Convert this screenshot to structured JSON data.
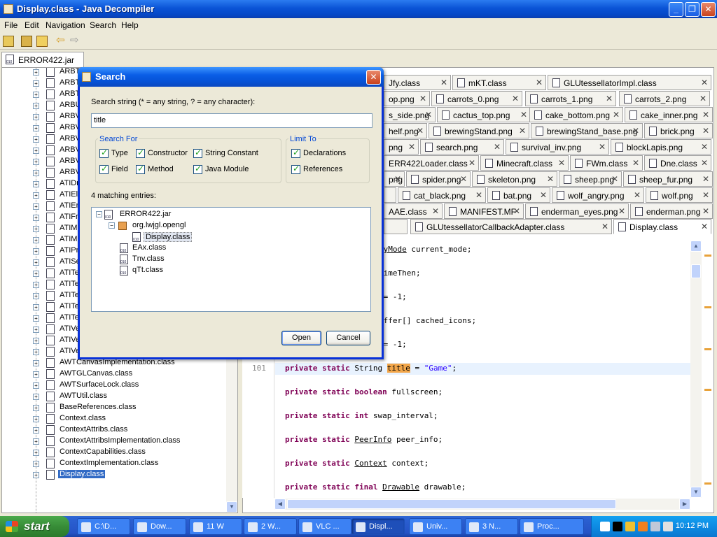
{
  "window": {
    "title": "Display.class - Java Decompiler"
  },
  "menu": [
    "File",
    "Edit",
    "Navigation",
    "Search",
    "Help"
  ],
  "jar_tab": "ERROR422.jar",
  "tree": {
    "items": [
      "ARBT",
      "ARBTr",
      "ARBTr",
      "ARBU",
      "ARBVe",
      "ARBVe",
      "ARBVe",
      "ARBVe",
      "ARBVe",
      "ARBVe",
      "ATIDr",
      "ATIEle",
      "ATIEn",
      "ATIFra",
      "ATIMa",
      "ATIMe",
      "ATIPn",
      "ATISe",
      "ATITe",
      "ATITe",
      "ATITe",
      "ATITe",
      "ATITe",
      "ATIVertexArrayObject.class",
      "ATIVertexAttribArrayObject.class",
      "ATIVertexStreams.class",
      "AWTCanvasImplementation.class",
      "AWTGLCanvas.class",
      "AWTSurfaceLock.class",
      "AWTUtil.class",
      "BaseReferences.class",
      "Context.class",
      "ContextAttribs.class",
      "ContextAttribsImplementation.class",
      "ContextCapabilities.class",
      "ContextImplementation.class",
      "Display.class"
    ]
  },
  "editor_tabs": [
    [
      "Jfy.class",
      "mKT.class",
      "GLUtessellatorImpl.class"
    ],
    [
      "op.png",
      "carrots_0.png",
      "carrots_1.png",
      "carrots_2.png"
    ],
    [
      "s_side.png",
      "cactus_top.png",
      "cake_bottom.png",
      "cake_inner.png"
    ],
    [
      "helf.png",
      "brewingStand.png",
      "brewingStand_base.png",
      "brick.png"
    ],
    [
      "png",
      "search.png",
      "survival_inv.png",
      "blockLapis.png"
    ],
    [
      "ERR422Loader.class",
      "Minecraft.class",
      "FWm.class",
      "Dne.class"
    ],
    [
      "png",
      "spider.png",
      "skeleton.png",
      "sheep.png",
      "sheep_fur.png"
    ],
    [
      "",
      "cat_black.png",
      "bat.png",
      "wolf_angry.png",
      "wolf.png"
    ],
    [
      "AAE.class",
      "MANIFEST.MF",
      "enderman_eyes.png",
      "enderman.png"
    ],
    [
      "",
      "GLUtessellatorCallbackAdapter.class",
      "Display.class"
    ]
  ],
  "code": {
    "lines": [
      {
        "pre": "",
        "kw": "",
        "mid": "",
        "ul": "ayMode",
        "rest": " current_mode;"
      },
      {
        "pre": "",
        "kw": "",
        "mid": "",
        "ul": "",
        "rest": "timeThen;"
      },
      {
        "pre": "",
        "kw": "",
        "mid": "",
        "ul": "",
        "rest": " = -1;"
      },
      {
        "pre": "",
        "kw": "",
        "mid": "",
        "ul": "",
        "rest": "uffer[] cached_icons;"
      },
      {
        "pre": "",
        "kw": "",
        "mid": "",
        "ul": "",
        "rest": " = -1;"
      }
    ],
    "current_line_number": "101",
    "line101": {
      "kw": "private static",
      "type": " String ",
      "hl": "title",
      "eq": " = ",
      "str": "\"Game\"",
      "end": ";"
    },
    "more": [
      {
        "kw": "private static boolean",
        "ul": "",
        "rest": " fullscreen;"
      },
      {
        "kw": "private static int",
        "ul": "",
        "rest": " swap_interval;"
      },
      {
        "kw": "private static",
        "ul": "PeerInfo",
        "rest": " peer_info;"
      },
      {
        "kw": "private static",
        "ul": "Context",
        "rest": " context;"
      },
      {
        "kw": "private static final",
        "ul": "Drawable",
        "rest": " drawable;"
      }
    ]
  },
  "dialog": {
    "title": "Search",
    "prompt": "Search string (* = any string, ? = any character):",
    "value": "title",
    "search_for": {
      "legend": "Search For",
      "options": [
        "Type",
        "Constructor",
        "String Constant",
        "Field",
        "Method",
        "Java Module"
      ]
    },
    "limit_to": {
      "legend": "Limit To",
      "options": [
        "Declarations",
        "References"
      ]
    },
    "matches": "4 matching entries:",
    "results": [
      "ERROR422.jar",
      "org.lwjgl.opengl",
      "Display.class",
      "EAx.class",
      "Tnv.class",
      "qTt.class"
    ],
    "open": "Open",
    "cancel": "Cancel"
  },
  "taskbar": {
    "start": "start",
    "tasks": [
      "C:\\D...",
      "Dow...",
      "11 W",
      "2 W...",
      "VLC ...",
      "Displ...",
      "Univ...",
      "3 N...",
      "Proc..."
    ],
    "clock": "10:12 PM"
  }
}
